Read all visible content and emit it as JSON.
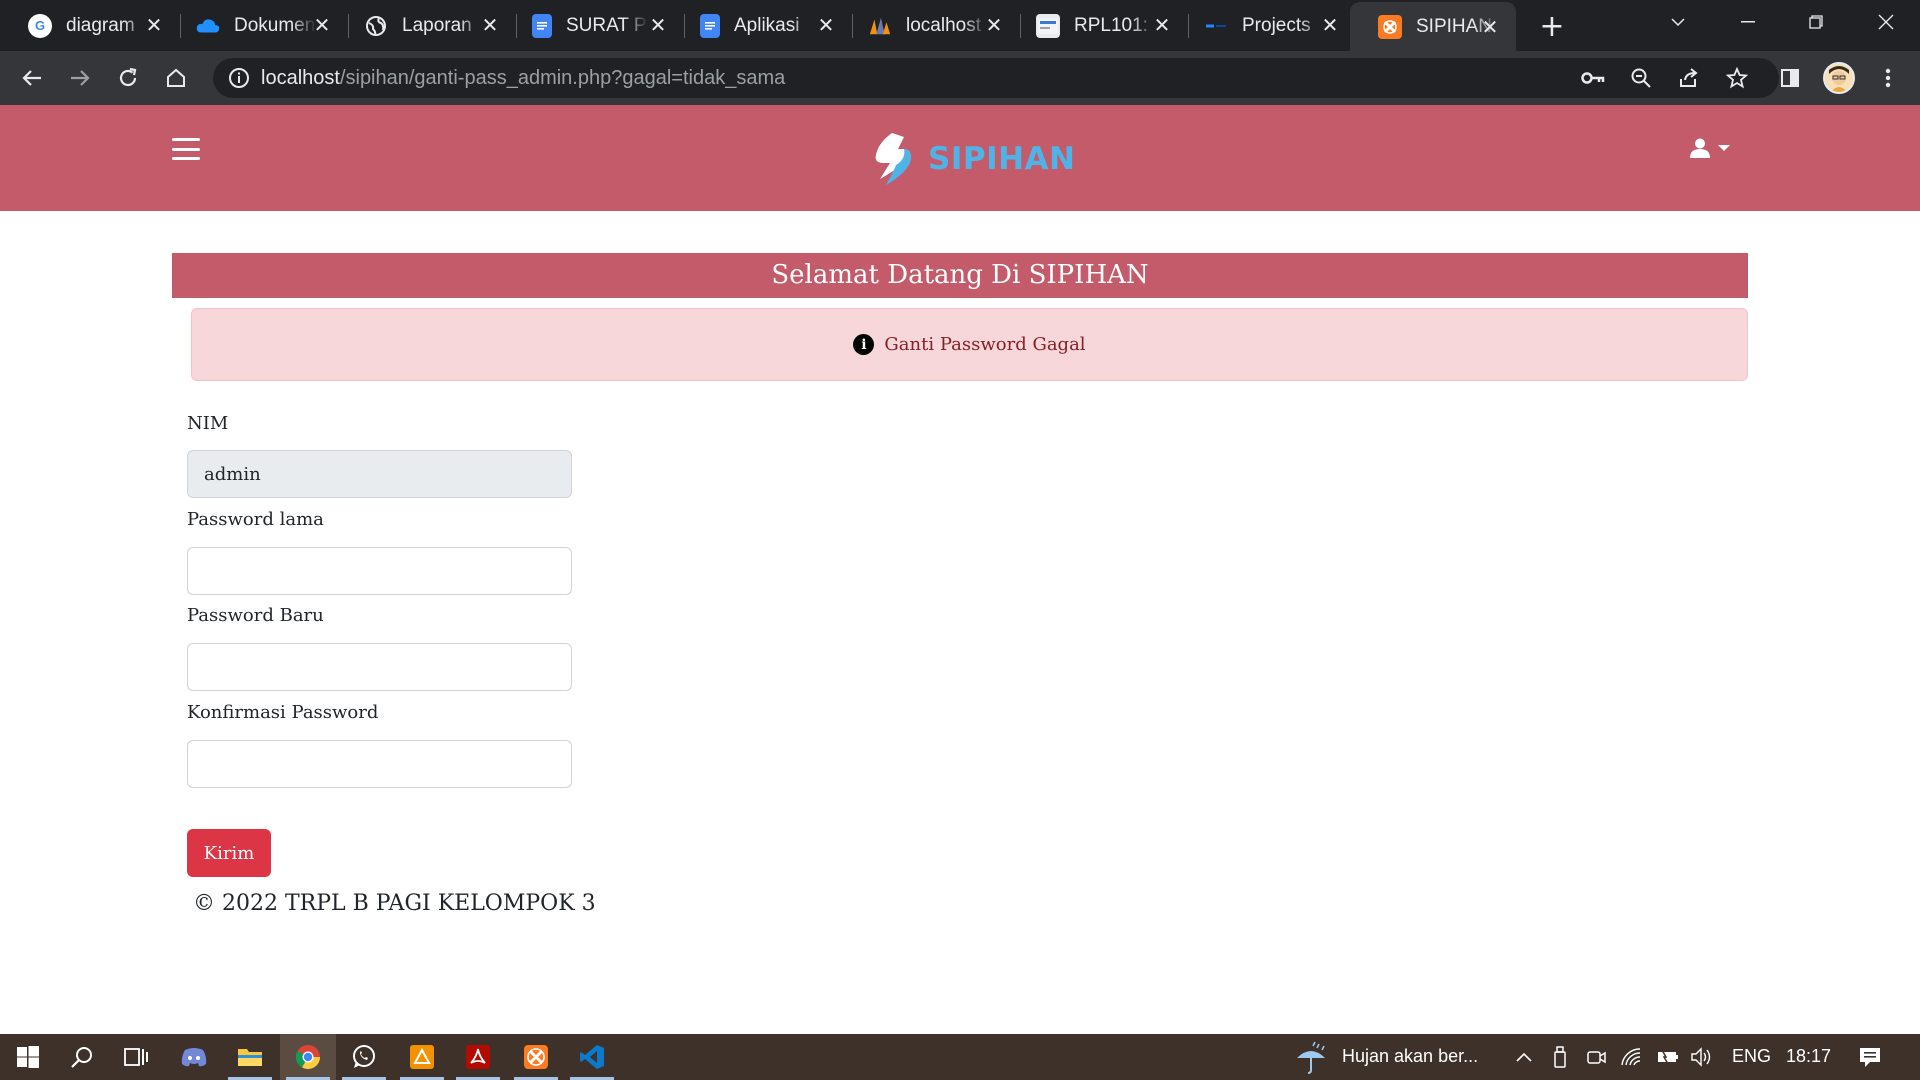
{
  "browser": {
    "tabs": [
      {
        "title": "diagram",
        "icon": "google-icon",
        "color": "#4285f4"
      },
      {
        "title": "Dokumen",
        "icon": "onedrive-icon",
        "color": "#0f6cbd"
      },
      {
        "title": "Laporan",
        "icon": "globe-icon",
        "color": "#9aa0a6"
      },
      {
        "title": "SURAT P",
        "icon": "google-docs-icon",
        "color": "#4285f4"
      },
      {
        "title": "Aplikasi",
        "icon": "google-docs-icon",
        "color": "#4285f4"
      },
      {
        "title": "localhost",
        "icon": "phpmyadmin-icon",
        "color": "#f29111"
      },
      {
        "title": "RPL101:",
        "icon": "moodle-icon",
        "color": "#dddddd"
      },
      {
        "title": "Projects",
        "icon": "jira-icon",
        "color": "#2684ff"
      },
      {
        "title": "SIPIHAN",
        "icon": "xampp-icon",
        "color": "#fb7a24"
      }
    ],
    "active_tab_index": 8,
    "url_host": "localhost",
    "url_path": "/sipihan/ganti-pass_admin.php?gagal=tidak_sama"
  },
  "app": {
    "brand": "SIPIHAN",
    "brand_color": "#4fb3e8",
    "navbar_color": "#c45b6b",
    "welcome": "Selamat Datang Di SIPIHAN",
    "alert_message": "Ganti Password Gagal",
    "form": {
      "nim_label": "NIM",
      "nim_value": "admin",
      "old_password_label": "Password lama",
      "new_password_label": "Password Baru",
      "confirm_password_label": "Konfirmasi Password",
      "submit_label": "Kirim"
    },
    "footer": "© 2022 TRPL B PAGI KELOMPOK 3"
  },
  "taskbar": {
    "apps": [
      "windows-start-icon",
      "search-icon",
      "task-view-icon",
      "discord-icon",
      "file-explorer-icon",
      "chrome-icon",
      "whatsapp-icon",
      "stackedit-icon",
      "acrobat-icon",
      "xampp-icon",
      "vscode-icon"
    ],
    "weather": "Hujan akan ber...",
    "language": "ENG",
    "time": "18:17"
  }
}
